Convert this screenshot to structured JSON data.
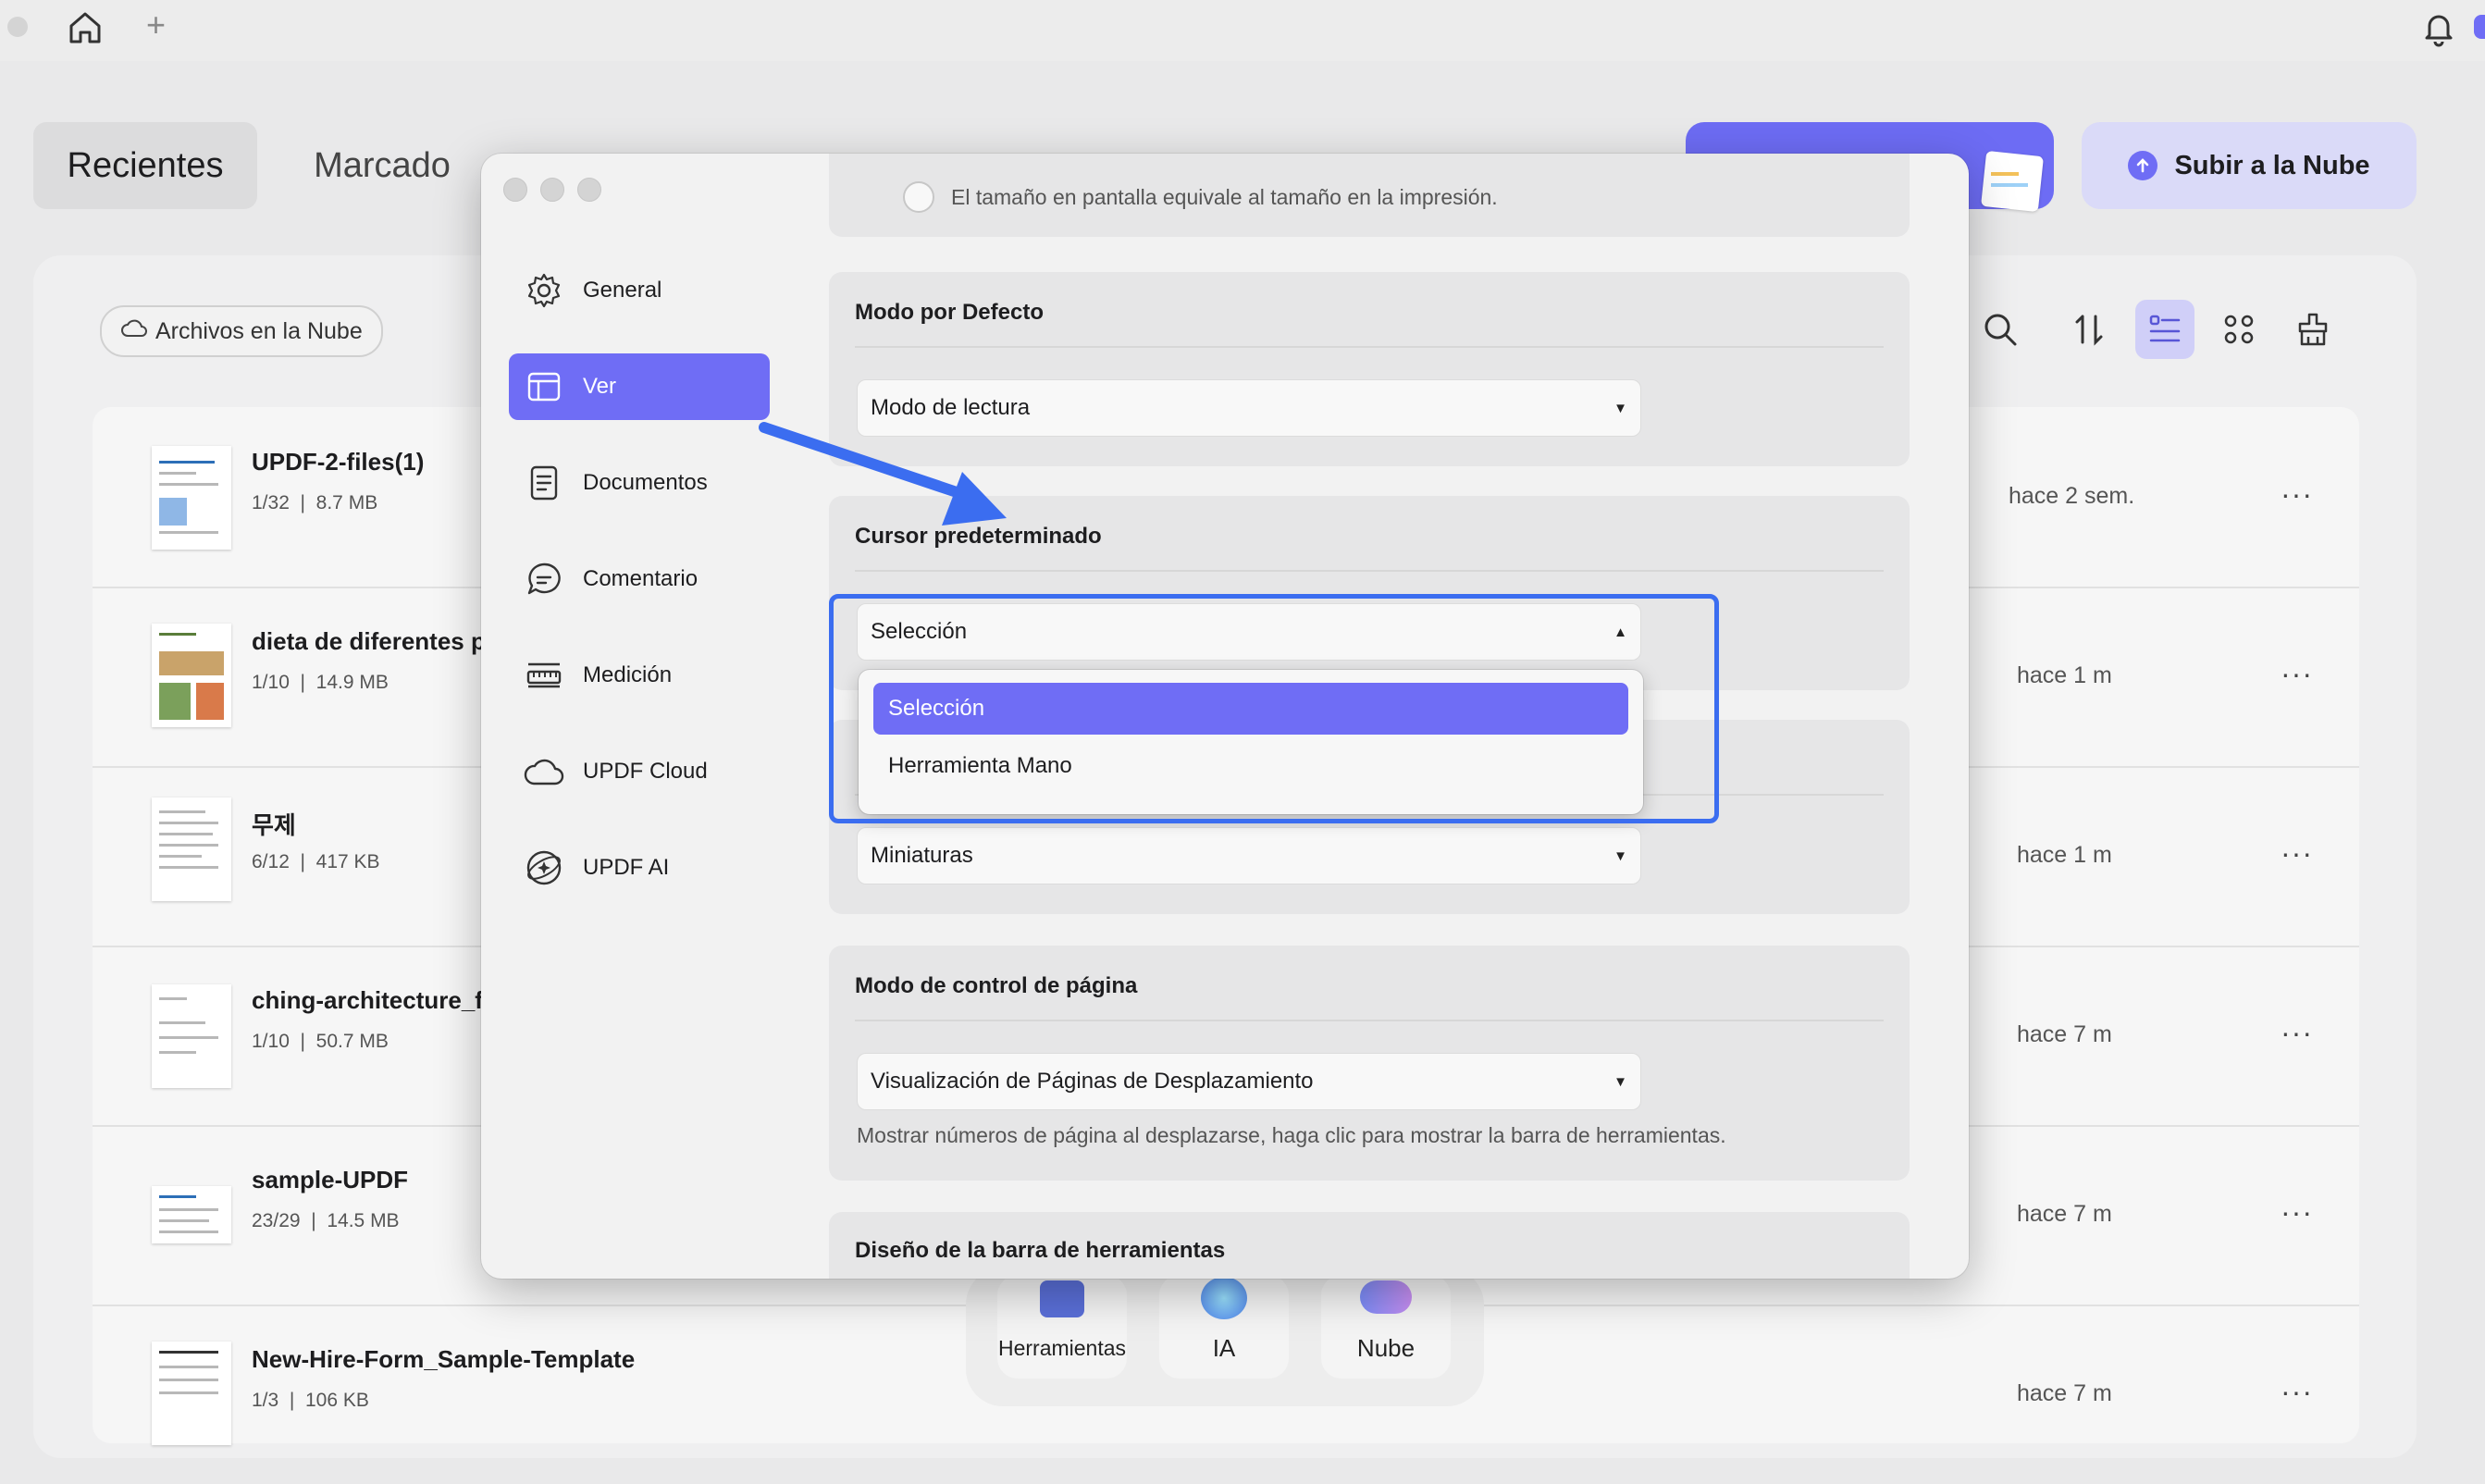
{
  "window": {
    "new_tab": "+"
  },
  "tabs": {
    "recent": "Recientes",
    "marked": "Marcado"
  },
  "actions": {
    "upload": "Subir a la Nube"
  },
  "filter": {
    "cloud_files": "Archivos en la Nube"
  },
  "files": [
    {
      "name": "UPDF-2-files(1)",
      "pages": "1/32",
      "size": "8.7 MB",
      "time": "hace 2 sem."
    },
    {
      "name": "dieta de diferentes pa",
      "pages": "1/10",
      "size": "14.9 MB",
      "time": "hace 1 m"
    },
    {
      "name": "무제",
      "pages": "6/12",
      "size": "417 KB",
      "time": "hace 1 m"
    },
    {
      "name": "ching-architecture_fo",
      "pages": "1/10",
      "size": "50.7 MB",
      "time": "hace 7 m"
    },
    {
      "name": "sample-UPDF",
      "pages": "23/29",
      "size": "14.5 MB",
      "time": "hace 7 m"
    },
    {
      "name": "New-Hire-Form_Sample-Template",
      "pages": "1/3",
      "size": "106 KB",
      "time": "hace 7 m"
    }
  ],
  "more_label": "···",
  "dock": {
    "tools": "Herramientas",
    "ai": "IA",
    "cloud": "Nube"
  },
  "dialog": {
    "sidebar": [
      {
        "label": "General",
        "icon": "gear-icon"
      },
      {
        "label": "Ver",
        "icon": "view-layout-icon"
      },
      {
        "label": "Documentos",
        "icon": "document-icon"
      },
      {
        "label": "Comentario",
        "icon": "comment-icon"
      },
      {
        "label": "Medición",
        "icon": "ruler-icon"
      },
      {
        "label": "UPDF Cloud",
        "icon": "cloud-icon"
      },
      {
        "label": "UPDF AI",
        "icon": "ai-icon"
      }
    ],
    "print_size_option": "El tamaño en pantalla equivale al tamaño en la impresión.",
    "default_mode": {
      "title": "Modo por Defecto",
      "value": "Modo de lectura"
    },
    "default_cursor": {
      "title": "Cursor predeterminado",
      "value": "Selección",
      "options": [
        "Selección",
        "Herramienta Mano"
      ]
    },
    "sidebar_mode": {
      "value": "Miniaturas"
    },
    "page_control": {
      "title": "Modo de control de página",
      "value": "Visualización de Páginas de Desplazamiento",
      "hint": "Mostrar números de página al desplazarse, haga clic para mostrar la barra de herramientas."
    },
    "toolbar_design": {
      "title": "Diseño de la barra de herramientas"
    }
  },
  "colors": {
    "accent": "#6f6df5",
    "annotation": "#3b6df0"
  }
}
